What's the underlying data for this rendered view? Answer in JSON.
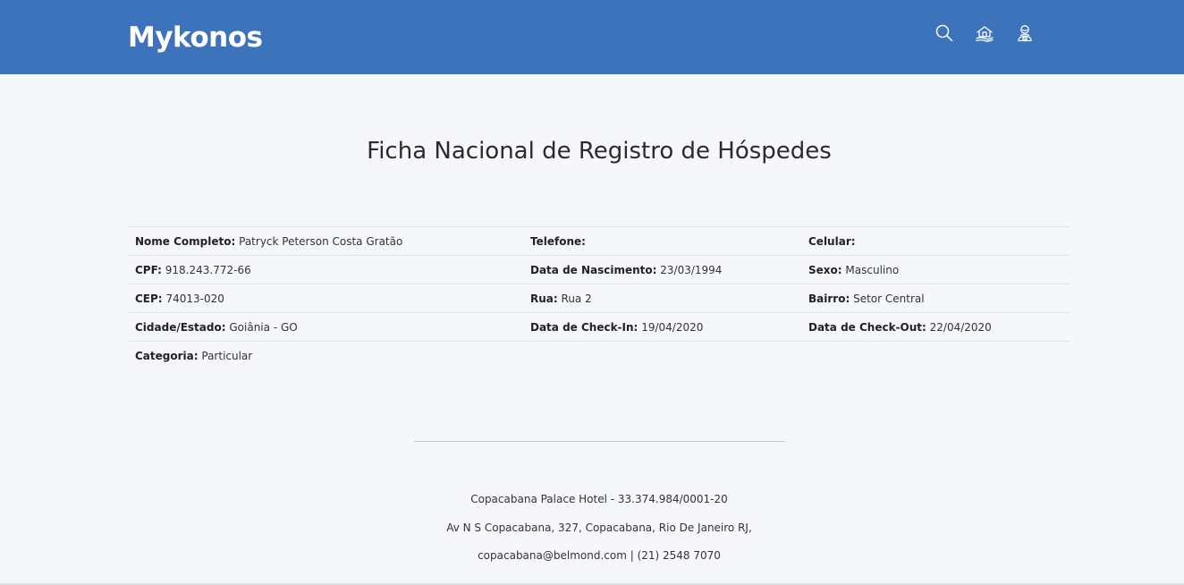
{
  "navbar": {
    "brand": "Mykonos",
    "icons": [
      "search-icon",
      "hotel-icon",
      "guest-icon"
    ]
  },
  "page": {
    "title": "Ficha Nacional de Registro de Hóspedes"
  },
  "guest": {
    "rows": [
      [
        {
          "label": "Nome Completo:",
          "value": "Patryck Peterson Costa Gratão"
        },
        {
          "label": "Telefone:",
          "value": ""
        },
        {
          "label": "Celular:",
          "value": ""
        }
      ],
      [
        {
          "label": "CPF:",
          "value": "918.243.772-66"
        },
        {
          "label": "Data de Nascimento:",
          "value": "23/03/1994"
        },
        {
          "label": "Sexo:",
          "value": "Masculino"
        }
      ],
      [
        {
          "label": "CEP:",
          "value": "74013-020"
        },
        {
          "label": "Rua:",
          "value": "Rua 2"
        },
        {
          "label": "Bairro:",
          "value": "Setor Central"
        }
      ],
      [
        {
          "label": "Cidade/Estado:",
          "value": "Goiânia - GO"
        },
        {
          "label": "Data de Check-In:",
          "value": "19/04/2020"
        },
        {
          "label": "Data de Check-Out:",
          "value": "22/04/2020"
        }
      ],
      [
        {
          "label": "Categoria:",
          "value": "Particular"
        }
      ]
    ]
  },
  "footer": {
    "line1": "Copacabana Palace Hotel - 33.374.984/0001-20",
    "line2": "Av N S Copacabana, 327, Copacabana, Rio De Janeiro RJ,",
    "line3": "copacabana@belmond.com | (21) 2548 7070"
  },
  "colors": {
    "navbar": "#3d73bb",
    "background": "#f5f7fa",
    "text": "#333333"
  }
}
